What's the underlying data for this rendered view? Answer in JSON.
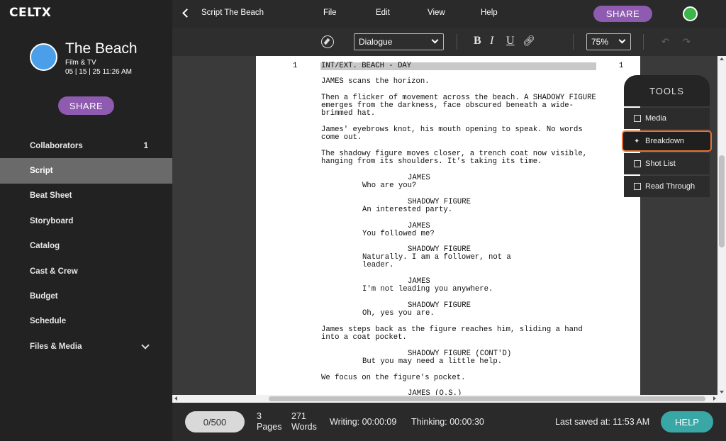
{
  "app": {
    "brand": "CELTX"
  },
  "project": {
    "title": "The Beach",
    "type": "Film & TV",
    "date": "05 | 15 | 25 11:26 AM",
    "share_label": "SHARE"
  },
  "sidebar": {
    "items": [
      {
        "label": "Collaborators",
        "count": "1"
      },
      {
        "label": "Script"
      },
      {
        "label": "Beat Sheet"
      },
      {
        "label": "Storyboard"
      },
      {
        "label": "Catalog"
      },
      {
        "label": "Cast & Crew"
      },
      {
        "label": "Budget"
      },
      {
        "label": "Schedule"
      },
      {
        "label": "Files & Media"
      }
    ],
    "active": "Script"
  },
  "topbar": {
    "doc_title": "Script The Beach",
    "menus": [
      "File",
      "Edit",
      "View",
      "Help"
    ],
    "share_label": "SHARE",
    "status_color": "#3cb54a"
  },
  "toolbar": {
    "element_type": "Dialogue",
    "bold": "B",
    "italic": "I",
    "underline": "U",
    "zoom": "75%",
    "icons": [
      "compass-icon",
      "link-icon",
      "undo-icon",
      "redo-icon"
    ]
  },
  "script": {
    "scene_number": "1",
    "lines": [
      "INT/EXT. BEACH - DAY",
      "JAMES scans the horizon.",
      "Then a flicker of movement across the beach. A SHADOWY FIGURE",
      "emerges from the darkness, face obscured beneath a wide-",
      "brimmed hat.",
      "James' eyebrows knot, his mouth opening to speak. No words",
      "come out.",
      "The shadowy figure moves closer, a trench coat now visible,",
      "hanging from its shoulders. It’s taking its time.",
      "JAMES",
      "Who are you?",
      "SHADOWY FIGURE",
      "An interested party.",
      "JAMES",
      "You followed me?",
      "SHADOWY FIGURE",
      "Naturally. I am a follower, not a",
      "leader.",
      "JAMES",
      "I'm not leading you anywhere.",
      "SHADOWY FIGURE",
      "Oh, yes you are.",
      "James steps back as the figure reaches him, sliding a hand",
      "into a coat pocket.",
      "SHADOWY FIGURE (CONT'D)",
      "But you may need a little help.",
      "We focus on the figure's pocket.",
      "JAMES (O.S.)"
    ]
  },
  "tools": {
    "header": "TOOLS",
    "items": [
      {
        "label": "Media",
        "icon": "media-icon"
      },
      {
        "label": "Breakdown",
        "icon": "wand-icon",
        "highlighted": true
      },
      {
        "label": "Shot List",
        "icon": "crop-icon"
      },
      {
        "label": "Read Through",
        "icon": "read-icon"
      }
    ]
  },
  "footer": {
    "word_limit": "0/500",
    "pages_num": "3",
    "pages_label": "Pages",
    "words_num": "271",
    "words_label": "Words",
    "writing": "Writing: 00:00:09",
    "thinking": "Thinking: 00:00:30",
    "last_saved": "Last saved at: 11:53 AM",
    "help_label": "HELP"
  }
}
